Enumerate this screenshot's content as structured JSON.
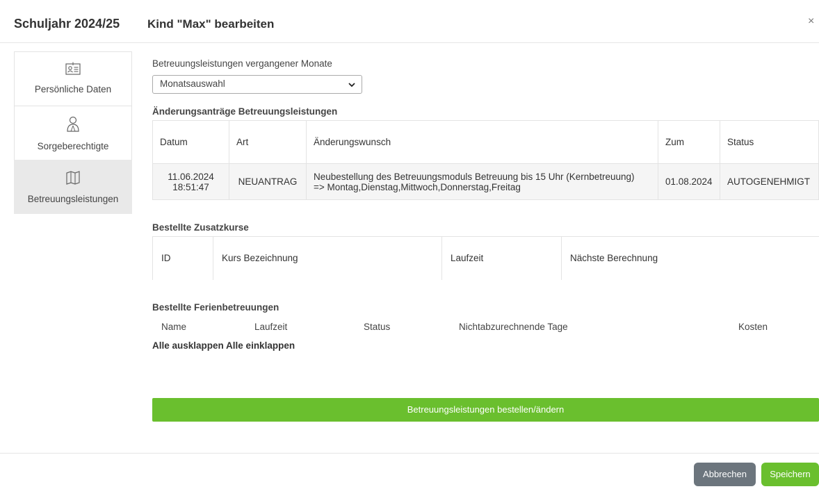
{
  "header": {
    "school_year": "Schuljahr 2024/25",
    "title": "Kind \"Max\" bearbeiten",
    "close": "×"
  },
  "sidebar": {
    "items": [
      {
        "label": "Persönliche Daten",
        "icon": "id-card-icon",
        "active": false
      },
      {
        "label": "Sorgeberechtigte",
        "icon": "guardians-icon",
        "active": false
      },
      {
        "label": "Betreuungsleistungen",
        "icon": "map-icon",
        "active": true
      }
    ]
  },
  "main": {
    "past_months_label": "Betreuungsleistungen vergangener Monate",
    "month_select_value": "Monatsauswahl",
    "change_requests_title": "Änderungsanträge Betreuungsleistungen",
    "change_requests": {
      "headers": [
        "Datum",
        "Art",
        "Änderungswunsch",
        "Zum",
        "Status"
      ],
      "rows": [
        {
          "date": "11.06.2024",
          "time": "18:51:47",
          "type": "NEUANTRAG",
          "wish_line1": "Neubestellung des Betreuungsmoduls Betreuung bis 15 Uhr (Kernbetreuung)",
          "wish_line2": "=> Montag,Dienstag,Mittwoch,Donnerstag,Freitag",
          "from": "01.08.2024",
          "status": "AUTOGENEHMIGT"
        }
      ]
    },
    "extra_courses_title": "Bestellte Zusatzkurse",
    "extra_courses": {
      "headers": [
        "ID",
        "Kurs Bezeichnung",
        "Laufzeit",
        "Nächste Berechnung"
      ]
    },
    "holiday_title": "Bestellte Ferienbetreuungen",
    "holiday": {
      "headers": [
        "Name",
        "Laufzeit",
        "Status",
        "Nichtabzurechnende Tage",
        "Kosten"
      ]
    },
    "expand_all": "Alle ausklappen",
    "collapse_all": "Alle einklappen",
    "order_button": "Betreuungsleistungen bestellen/ändern"
  },
  "footer": {
    "cancel": "Abbrechen",
    "save": "Speichern"
  },
  "colors": {
    "accent_green": "#6abf2e",
    "cancel_gray": "#6c757d",
    "active_sidebar": "#e9e9e9"
  }
}
